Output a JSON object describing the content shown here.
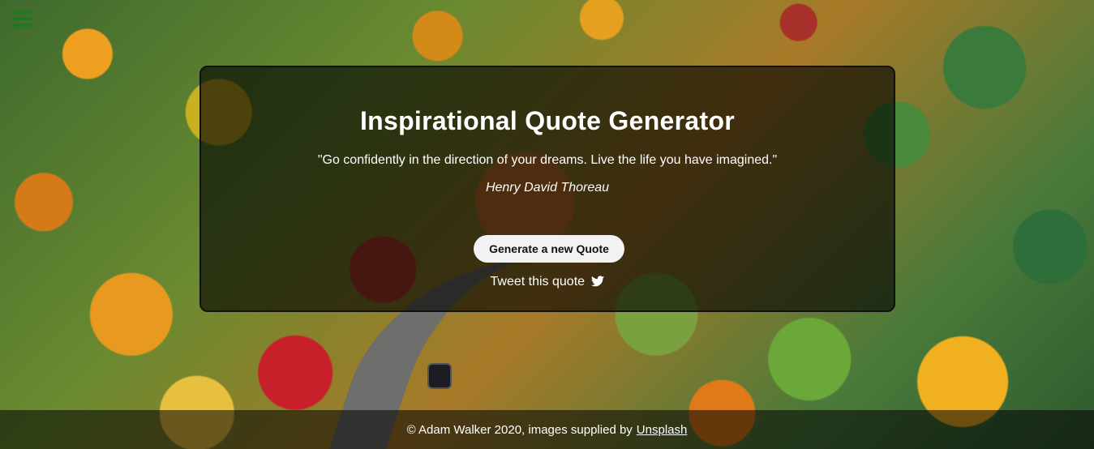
{
  "app": {
    "title": "Inspirational Quote Generator"
  },
  "quote": {
    "text": "\"Go confidently in the direction of your dreams. Live the life you have imagined.\"",
    "author": "Henry David Thoreau"
  },
  "actions": {
    "generate_label": "Generate a new Quote",
    "tweet_label": "Tweet this quote"
  },
  "footer": {
    "credit_text": "© Adam Walker 2020, images supplied by",
    "link_label": "Unsplash"
  },
  "icons": {
    "menu": "hamburger-menu-icon",
    "tweet": "twitter-bird-icon"
  },
  "colors": {
    "menu_icon": "#1f7a1f",
    "card_bg": "rgba(0,0,0,0.62)",
    "button_bg": "#f2f2f2"
  }
}
